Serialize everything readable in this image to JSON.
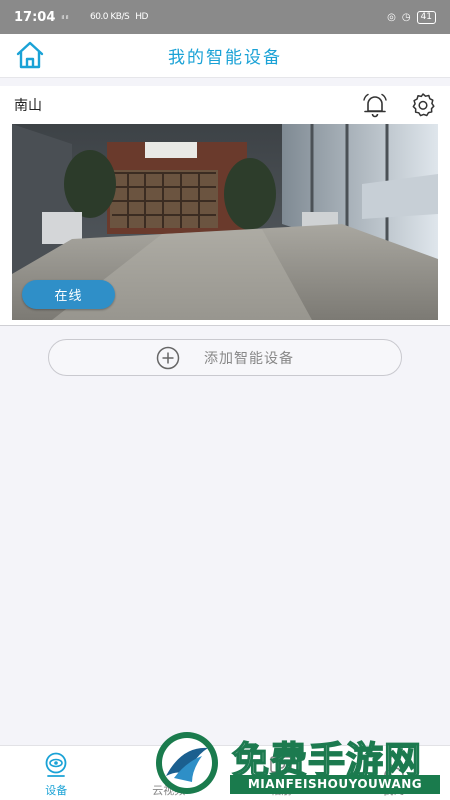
{
  "status_bar": {
    "time": "17:04",
    "signal": "ᵢₗ ᵢₗ",
    "net_speed": "60.0 KB/S",
    "network": "HD",
    "battery": "41"
  },
  "header": {
    "title": "我的智能设备",
    "home_icon": "home-icon"
  },
  "device": {
    "name": "南山",
    "status": "在线",
    "bell_icon": "bell-icon",
    "settings_icon": "gear-icon"
  },
  "add_device": {
    "label": "添加智能设备",
    "icon": "plus-circle-icon"
  },
  "tabs": [
    {
      "label": "设备",
      "icon": "camera-eye-icon",
      "active": true
    },
    {
      "label": "云视频",
      "icon": "cloud-icon",
      "active": false
    },
    {
      "label": "相册",
      "icon": "album-icon",
      "active": false
    },
    {
      "label": "我的",
      "icon": "person-icon",
      "active": false
    }
  ],
  "watermark": {
    "title": "免费手游网",
    "subtitle": "MIANFEISHOUYOUWANG"
  },
  "colors": {
    "accent": "#1aa2d6",
    "online_pill": "#2f8fc8",
    "watermark_green": "#1a7b4d"
  }
}
